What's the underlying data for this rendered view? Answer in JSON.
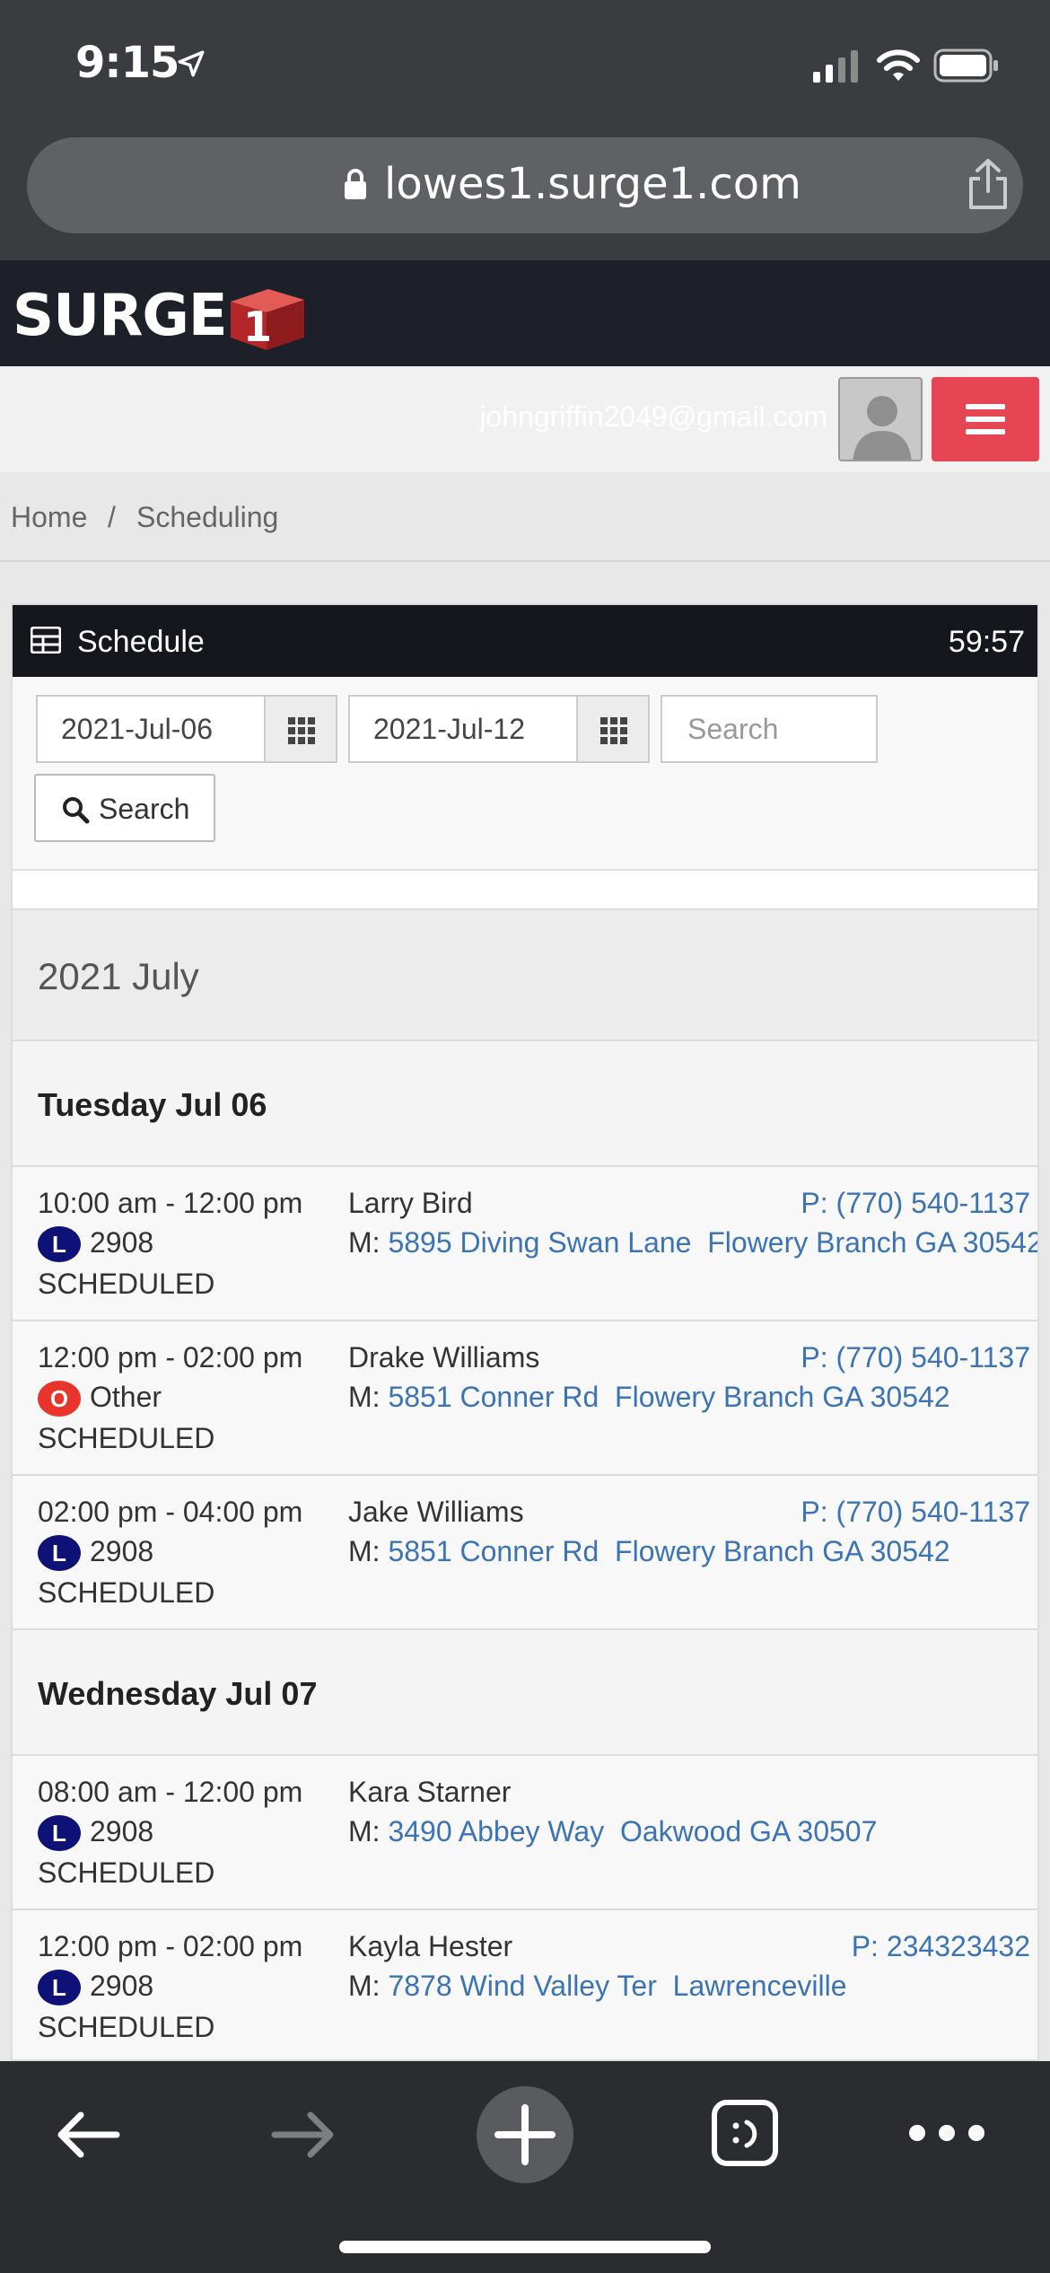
{
  "status_bar": {
    "time": "9:15"
  },
  "browser": {
    "url": "lowes1.surge1.com"
  },
  "site": {
    "logo_text": "SURGE",
    "logo_digit": "1",
    "user_email": "johngriffin2049@gmail.com",
    "accent_color": "#e64553"
  },
  "breadcrumb": {
    "home": "Home",
    "separator": "/",
    "current": "Scheduling"
  },
  "panel": {
    "title": "Schedule",
    "timer": "59:57",
    "start_date": "2021-Jul-06",
    "end_date": "2021-Jul-12",
    "search_placeholder": "Search",
    "search_button": "Search",
    "month_label": "2021 July"
  },
  "days": [
    {
      "label": "Tuesday Jul 06",
      "appointments": [
        {
          "time": "10:00 am - 12:00 pm",
          "badge": "L",
          "store": "2908",
          "status": "SCHEDULED",
          "name": "Larry Bird",
          "phone": "P: (770) 540-1137",
          "addr_prefix": "M:",
          "street": "5895 Diving Swan Lane",
          "city": "Flowery Branch GA 30542"
        },
        {
          "time": "12:00 pm - 02:00 pm",
          "badge": "O",
          "store": "Other",
          "status": "SCHEDULED",
          "name": "Drake Williams",
          "phone": "P: (770) 540-1137",
          "addr_prefix": "M:",
          "street": "5851 Conner Rd",
          "city": "Flowery Branch GA 30542"
        },
        {
          "time": "02:00 pm - 04:00 pm",
          "badge": "L",
          "store": "2908",
          "status": "SCHEDULED",
          "name": "Jake Williams",
          "phone": "P: (770) 540-1137",
          "addr_prefix": "M:",
          "street": "5851 Conner Rd",
          "city": "Flowery Branch GA 30542"
        }
      ]
    },
    {
      "label": "Wednesday Jul 07",
      "appointments": [
        {
          "time": "08:00 am - 12:00 pm",
          "badge": "L",
          "store": "2908",
          "status": "SCHEDULED",
          "name": "Kara Starner",
          "phone": "",
          "addr_prefix": "M:",
          "street": "3490 Abbey Way",
          "city": "Oakwood GA 30507"
        },
        {
          "time": "12:00 pm - 02:00 pm",
          "badge": "L",
          "store": "2908",
          "status": "SCHEDULED",
          "name": "Kayla Hester",
          "phone": "P: 234323432",
          "addr_prefix": "M:",
          "street": "7878 Wind Valley Ter",
          "city": "Lawrenceville"
        }
      ]
    }
  ],
  "icons": {
    "location": "location-arrow-icon",
    "signal": "cell-signal-icon",
    "wifi": "wifi-icon",
    "battery": "battery-icon",
    "lock": "lock-icon",
    "share": "share-icon",
    "grid": "grid-icon",
    "calendar": "calendar-grid-icon",
    "search": "search-icon"
  }
}
